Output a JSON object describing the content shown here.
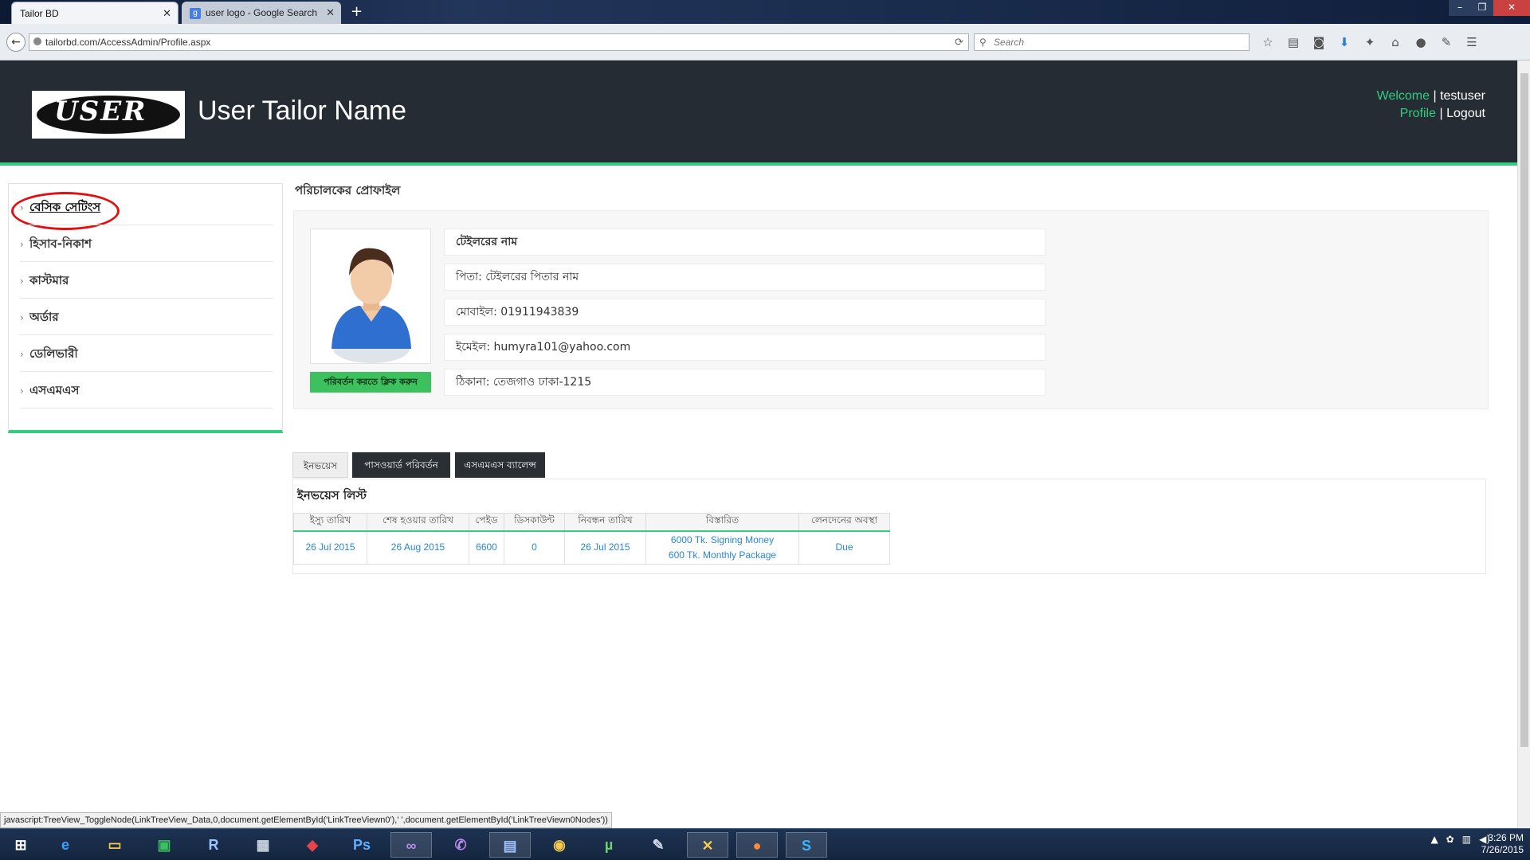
{
  "browser": {
    "tabs": [
      {
        "title": "Tailor BD",
        "active": true
      },
      {
        "title": "user logo - Google Search",
        "active": false
      }
    ],
    "url": "tailorbd.com/AccessAdmin/Profile.aspx",
    "search_placeholder": "Search"
  },
  "header": {
    "logo_text": "USER",
    "site_title": "User Tailor Name",
    "welcome_label": "Welcome",
    "username": "testuser",
    "profile_link": "Profile",
    "logout_link": "Logout"
  },
  "sidebar": {
    "items": [
      {
        "label": "বেসিক সেটিংস"
      },
      {
        "label": "হিসাব-নিকাশ"
      },
      {
        "label": "কাস্টমার"
      },
      {
        "label": "অর্ডার"
      },
      {
        "label": "ডেলিভারী"
      },
      {
        "label": "এসএমএস"
      }
    ]
  },
  "profile": {
    "heading": "পরিচালকের প্রোফাইল",
    "name": "টেইলরের নাম",
    "father": "পিতা: টেইলরের পিতার নাম",
    "mobile": "মোবাইল: 01911943839",
    "email": "ইমেইল: humyra101@yahoo.com",
    "address": "ঠিকানা: তেজগাও ঢাকা-1215",
    "change_button": "পরিবর্তন করতে ক্লিক করুন"
  },
  "tabs": {
    "invoice": "ইনভয়েস",
    "password": "পাসওয়ার্ড পরিবর্তন",
    "sms": "এসএমএস ব্যালেন্স"
  },
  "invoice": {
    "title": "ইনভয়েস লিস্ট",
    "columns": [
      "ইস্যু তারিখ",
      "শেষ হওয়ার তারিখ",
      "পেইড",
      "ডিসকাউন্ট",
      "নিবন্ধন তারিখ",
      "বিস্তারিত",
      "লেনদেনের অবস্থা"
    ],
    "rows": [
      {
        "issue_date": "26 Jul 2015",
        "end_date": "26 Aug 2015",
        "paid": "6600",
        "discount": "0",
        "reg_date": "26 Jul 2015",
        "details_1": "6000 Tk. Signing Money",
        "details_2": "600 Tk. Monthly Package",
        "status": "Due"
      }
    ]
  },
  "status_bar": "javascript:TreeView_ToggleNode(LinkTreeView_Data,0,document.getElementById('LinkTreeViewn0'),' ',document.getElementById('LinkTreeViewn0Nodes'))",
  "clock": {
    "time": "3:26 PM",
    "date": "7/26/2015"
  },
  "colors": {
    "accent": "#33cc80",
    "header_bg": "#252c34",
    "link": "#2a86d4",
    "highlight_circle": "#e01010"
  }
}
